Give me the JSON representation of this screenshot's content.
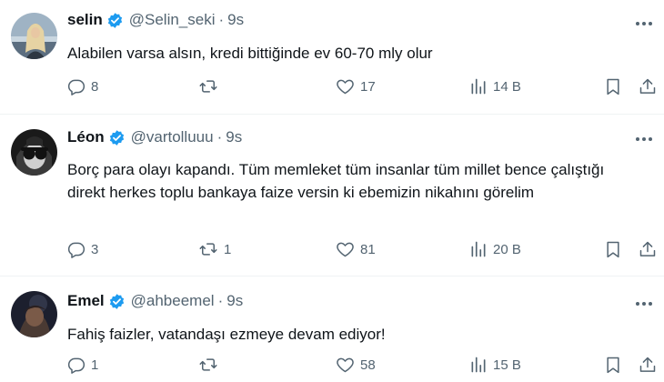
{
  "tweets": [
    {
      "name": "selin",
      "handle": "@Selin_seki",
      "time": "9s",
      "text": "Alabilen varsa alsın, kredi bittiğinde ev 60-70 mly olur",
      "replies": "8",
      "retweets": "",
      "likes": "17",
      "views": "14 B"
    },
    {
      "name": "Léon",
      "handle": "@vartolluuu",
      "time": "9s",
      "text": "Borç para olayı kapandı. Tüm memleket tüm insanlar tüm millet bence çalıştığı direkt herkes toplu bankaya faize versin ki ebemizin nikahını görelim",
      "replies": "3",
      "retweets": "1",
      "likes": "81",
      "views": "20 B"
    },
    {
      "name": "Emel",
      "handle": "@ahbeemel",
      "time": "9s",
      "text": "Fahiş faizler, vatandaşı ezmeye devam ediyor!",
      "replies": "1",
      "retweets": "",
      "likes": "58",
      "views": "15 B"
    }
  ],
  "ui": {
    "separator": "·",
    "colors": {
      "verified": "#1d9bf0",
      "text": "#0f1419",
      "muted": "#536471",
      "divider": "#eff3f4"
    }
  }
}
